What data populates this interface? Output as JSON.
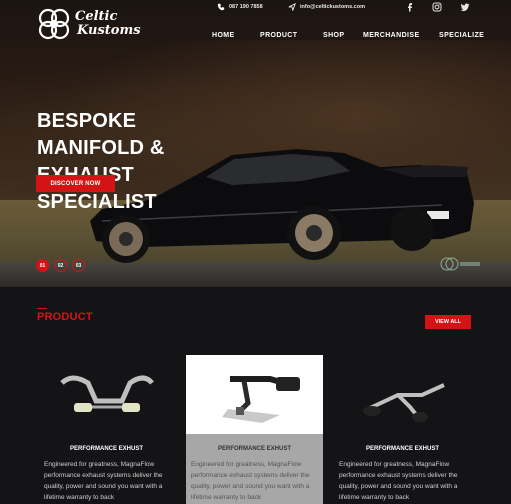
{
  "brand": {
    "line1": "Celtic",
    "line2": "Kustoms"
  },
  "contact": {
    "phone": "087 190 7858",
    "email": "info@celtickustoms.com"
  },
  "social": [
    "facebook-icon",
    "instagram-icon",
    "twitter-icon"
  ],
  "nav": {
    "home": "HOME",
    "product": "PRODUCT",
    "shop": "SHOP",
    "merchandise": "MERCHANDISE",
    "specialize": "SPECIALIZE"
  },
  "hero": {
    "title": "BESPOKE MANIFOLD & EXHAUST SPECIALIST",
    "button": "DISCOVER NOW",
    "slides": [
      "01",
      "02",
      "03"
    ],
    "active_slide": 0
  },
  "products": {
    "heading": "PRODUCT",
    "view_all": "VIEW ALL",
    "items": [
      {
        "title": "PERFORMANCE EXHUST",
        "desc": "Engineered for greatness, MagnaFlow performance exhaust systems deliver the quality, power and sound you want with a lifetime warranty to back"
      },
      {
        "title": "PERFORMANCE EXHUST",
        "desc": "Engineered for greatness, MagnaFlow performance exhaust systems deliver the quality, power and sound you want with a lifetime warranty to back"
      },
      {
        "title": "PERFORMANCE EXHUST",
        "desc": "Engineered for greatness, MagnaFlow performance exhaust systems deliver the quality, power and sound you want with a lifetime warranty to back"
      }
    ]
  },
  "colors": {
    "accent": "#d41414",
    "background": "#141417"
  }
}
